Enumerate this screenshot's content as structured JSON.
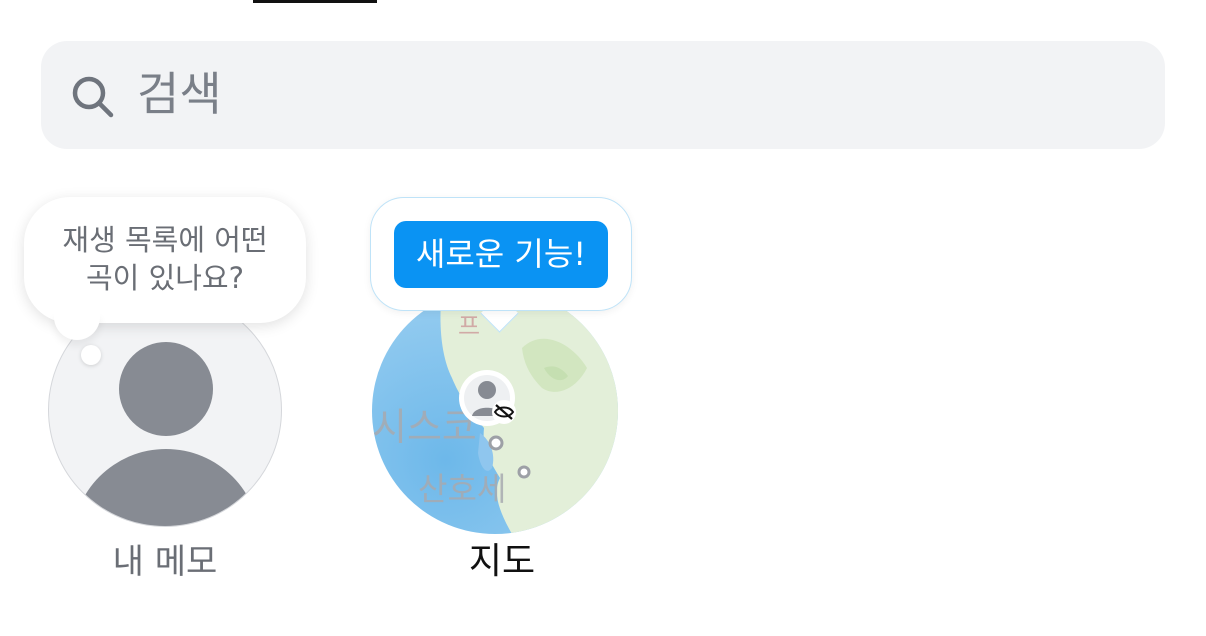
{
  "search": {
    "placeholder": "검색"
  },
  "notes": [
    {
      "bubble_line1": "재생 목록에 어떤",
      "bubble_line2": "곡이 있나요?",
      "label": "내 메모"
    },
    {
      "badge": "새로운 기능!",
      "label": "지도",
      "map_labels": {
        "place1": "시스코",
        "place2": "산호세",
        "place3": "프"
      }
    }
  ],
  "colors": {
    "accent": "#0a93f3",
    "search_bg": "#f2f3f5",
    "avatar_gray": "#878b93"
  }
}
